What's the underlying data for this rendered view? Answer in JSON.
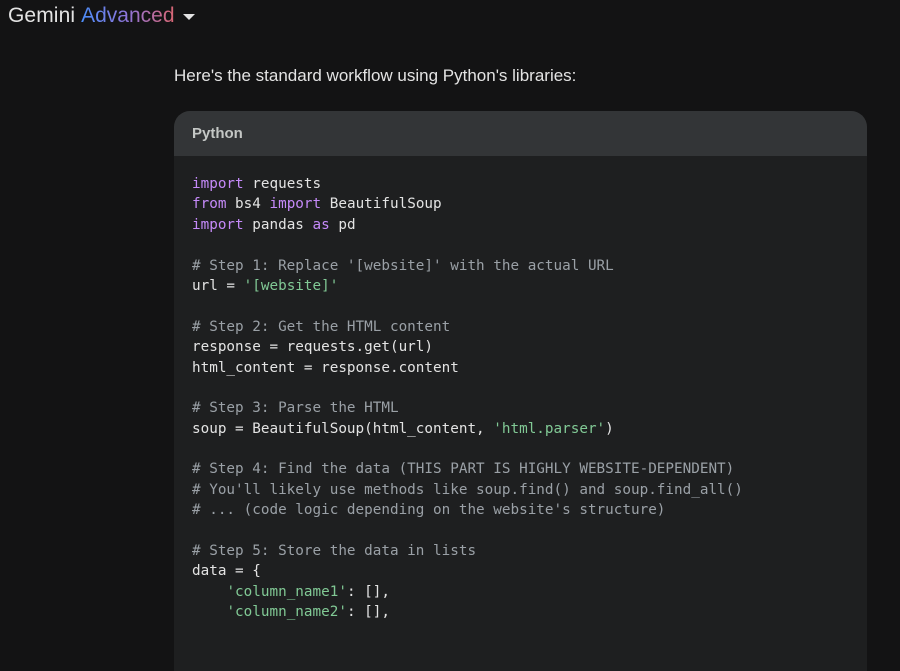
{
  "header": {
    "brand": "Gemini",
    "tier": "Advanced"
  },
  "intro_text": "Here's the standard workflow using Python's libraries:",
  "code_block": {
    "language": "Python",
    "lines": [
      [
        {
          "t": "import",
          "c": "kw"
        },
        {
          "t": " requests",
          "c": ""
        }
      ],
      [
        {
          "t": "from",
          "c": "kw"
        },
        {
          "t": " bs4 ",
          "c": ""
        },
        {
          "t": "import",
          "c": "kw"
        },
        {
          "t": " BeautifulSoup",
          "c": ""
        }
      ],
      [
        {
          "t": "import",
          "c": "kw"
        },
        {
          "t": " pandas ",
          "c": ""
        },
        {
          "t": "as",
          "c": "kw"
        },
        {
          "t": " pd",
          "c": ""
        }
      ],
      [],
      [
        {
          "t": "# Step 1: Replace '[website]' with the actual URL",
          "c": "cm"
        }
      ],
      [
        {
          "t": "url = ",
          "c": ""
        },
        {
          "t": "'[website]'",
          "c": "st"
        }
      ],
      [],
      [
        {
          "t": "# Step 2: Get the HTML content",
          "c": "cm"
        }
      ],
      [
        {
          "t": "response = requests.get(url)",
          "c": ""
        }
      ],
      [
        {
          "t": "html_content = response.content",
          "c": ""
        }
      ],
      [],
      [
        {
          "t": "# Step 3: Parse the HTML",
          "c": "cm"
        }
      ],
      [
        {
          "t": "soup = BeautifulSoup(html_content, ",
          "c": ""
        },
        {
          "t": "'html.parser'",
          "c": "st"
        },
        {
          "t": ")",
          "c": ""
        }
      ],
      [],
      [
        {
          "t": "# Step 4: Find the data (THIS PART IS HIGHLY WEBSITE-DEPENDENT)",
          "c": "cm"
        }
      ],
      [
        {
          "t": "# You'll likely use methods like soup.find() and soup.find_all()",
          "c": "cm"
        }
      ],
      [
        {
          "t": "# ... (code logic depending on the website's structure)",
          "c": "cm"
        }
      ],
      [],
      [
        {
          "t": "# Step 5: Store the data in lists",
          "c": "cm"
        }
      ],
      [
        {
          "t": "data = {",
          "c": ""
        }
      ],
      [
        {
          "t": "    ",
          "c": ""
        },
        {
          "t": "'column_name1'",
          "c": "st"
        },
        {
          "t": ": [],",
          "c": ""
        }
      ],
      [
        {
          "t": "    ",
          "c": ""
        },
        {
          "t": "'column_name2'",
          "c": "st"
        },
        {
          "t": ": [],",
          "c": ""
        }
      ]
    ]
  },
  "colors": {
    "background": "#131314",
    "code_background": "#1e1f20",
    "code_header": "#333537",
    "keyword": "#c58af9",
    "comment": "#9aa0a6",
    "string": "#81c995"
  }
}
